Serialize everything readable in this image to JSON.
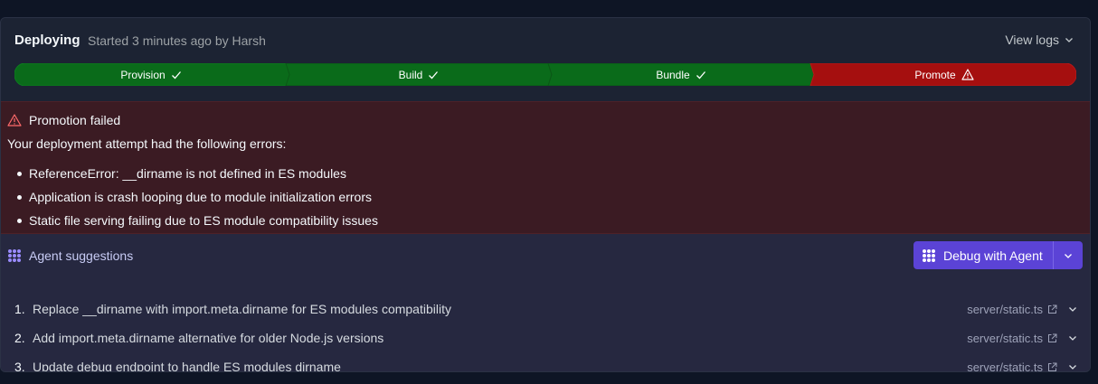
{
  "header": {
    "status": "Deploying",
    "subtitle": "Started 3 minutes ago by Harsh",
    "view_logs": "View logs"
  },
  "stages": [
    {
      "label": "Provision",
      "state": "success",
      "icon": "check-icon"
    },
    {
      "label": "Build",
      "state": "success",
      "icon": "check-icon"
    },
    {
      "label": "Bundle",
      "state": "success",
      "icon": "check-icon"
    },
    {
      "label": "Promote",
      "state": "failed",
      "icon": "warning-icon"
    }
  ],
  "error": {
    "title": "Promotion failed",
    "intro": "Your deployment attempt had the following errors:",
    "items": [
      "ReferenceError: __dirname is not defined in ES modules",
      "Application is crash looping due to module initialization errors",
      "Static file serving failing due to ES module compatibility issues"
    ]
  },
  "agent": {
    "title": "Agent suggestions",
    "debug_button": "Debug with Agent",
    "suggestions": [
      {
        "num": "1.",
        "text": "Replace __dirname with import.meta.dirname for ES modules compatibility",
        "file": "server/static.ts"
      },
      {
        "num": "2.",
        "text": "Add import.meta.dirname alternative for older Node.js versions",
        "file": "server/static.ts"
      },
      {
        "num": "3.",
        "text": "Update debug endpoint to handle ES modules dirname",
        "file": "server/static.ts"
      }
    ]
  },
  "colors": {
    "success": "#0a6b1a",
    "failed": "#a50f0f",
    "accent": "#5b43d6"
  }
}
